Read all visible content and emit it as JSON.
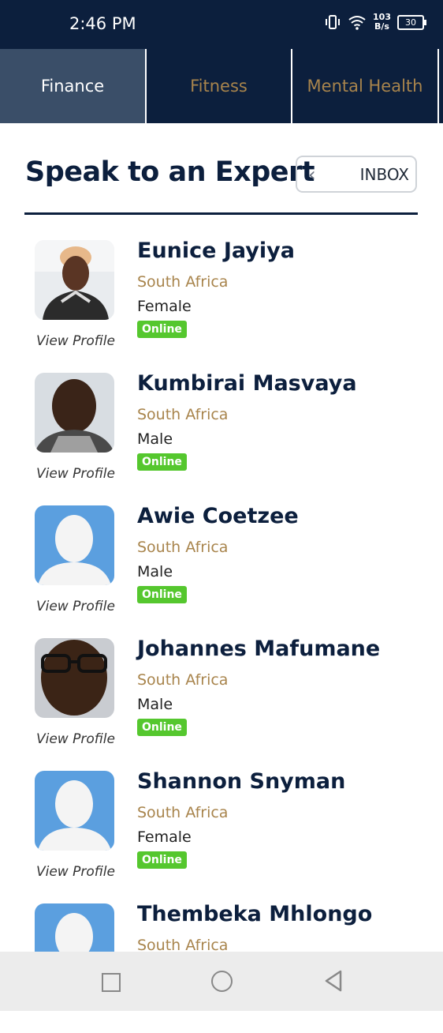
{
  "status": {
    "time": "2:46 PM",
    "netspeed_value": "103",
    "netspeed_unit": "B/s",
    "battery": "30"
  },
  "tabs": [
    {
      "label": "Finance",
      "active": true
    },
    {
      "label": "Fitness",
      "active": false
    },
    {
      "label": "Mental Health",
      "active": false
    }
  ],
  "header": {
    "title": "Speak to an Expert",
    "inbox_label": "INBOX"
  },
  "experts": [
    {
      "name": "Eunice Jayiya",
      "country": "South Africa",
      "gender": "Female",
      "status": "Online",
      "view_profile": "View Profile",
      "avatar": "photo"
    },
    {
      "name": "Kumbirai Masvaya",
      "country": "South Africa",
      "gender": "Male",
      "status": "Online",
      "view_profile": "View Profile",
      "avatar": "photo"
    },
    {
      "name": "Awie Coetzee",
      "country": "South Africa",
      "gender": "Male",
      "status": "Online",
      "view_profile": "View Profile",
      "avatar": "placeholder"
    },
    {
      "name": "Johannes Mafumane",
      "country": "South Africa",
      "gender": "Male",
      "status": "Online",
      "view_profile": "View Profile",
      "avatar": "photo"
    },
    {
      "name": "Shannon Snyman",
      "country": "South Africa",
      "gender": "Female",
      "status": "Online",
      "view_profile": "View Profile",
      "avatar": "placeholder"
    },
    {
      "name": "Thembeka Mhlongo",
      "country": "South Africa",
      "gender": "",
      "status": "",
      "view_profile": "",
      "avatar": "placeholder"
    }
  ],
  "colors": {
    "navy": "#0c1f3d",
    "gold": "#a8844c",
    "online": "#55c72e",
    "avatar_placeholder": "#5b9fdf"
  }
}
